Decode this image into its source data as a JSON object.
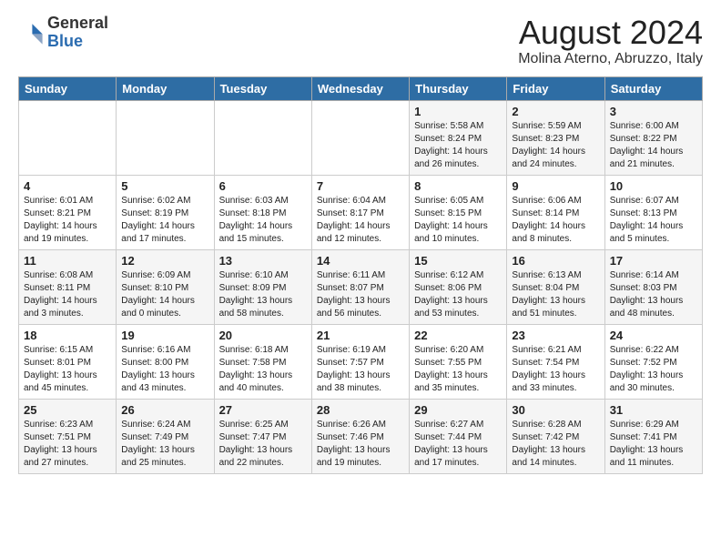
{
  "logo": {
    "general": "General",
    "blue": "Blue"
  },
  "header": {
    "month_year": "August 2024",
    "location": "Molina Aterno, Abruzzo, Italy"
  },
  "days_of_week": [
    "Sunday",
    "Monday",
    "Tuesday",
    "Wednesday",
    "Thursday",
    "Friday",
    "Saturday"
  ],
  "weeks": [
    [
      {
        "day": "",
        "info": ""
      },
      {
        "day": "",
        "info": ""
      },
      {
        "day": "",
        "info": ""
      },
      {
        "day": "",
        "info": ""
      },
      {
        "day": "1",
        "info": "Sunrise: 5:58 AM\nSunset: 8:24 PM\nDaylight: 14 hours\nand 26 minutes."
      },
      {
        "day": "2",
        "info": "Sunrise: 5:59 AM\nSunset: 8:23 PM\nDaylight: 14 hours\nand 24 minutes."
      },
      {
        "day": "3",
        "info": "Sunrise: 6:00 AM\nSunset: 8:22 PM\nDaylight: 14 hours\nand 21 minutes."
      }
    ],
    [
      {
        "day": "4",
        "info": "Sunrise: 6:01 AM\nSunset: 8:21 PM\nDaylight: 14 hours\nand 19 minutes."
      },
      {
        "day": "5",
        "info": "Sunrise: 6:02 AM\nSunset: 8:19 PM\nDaylight: 14 hours\nand 17 minutes."
      },
      {
        "day": "6",
        "info": "Sunrise: 6:03 AM\nSunset: 8:18 PM\nDaylight: 14 hours\nand 15 minutes."
      },
      {
        "day": "7",
        "info": "Sunrise: 6:04 AM\nSunset: 8:17 PM\nDaylight: 14 hours\nand 12 minutes."
      },
      {
        "day": "8",
        "info": "Sunrise: 6:05 AM\nSunset: 8:15 PM\nDaylight: 14 hours\nand 10 minutes."
      },
      {
        "day": "9",
        "info": "Sunrise: 6:06 AM\nSunset: 8:14 PM\nDaylight: 14 hours\nand 8 minutes."
      },
      {
        "day": "10",
        "info": "Sunrise: 6:07 AM\nSunset: 8:13 PM\nDaylight: 14 hours\nand 5 minutes."
      }
    ],
    [
      {
        "day": "11",
        "info": "Sunrise: 6:08 AM\nSunset: 8:11 PM\nDaylight: 14 hours\nand 3 minutes."
      },
      {
        "day": "12",
        "info": "Sunrise: 6:09 AM\nSunset: 8:10 PM\nDaylight: 14 hours\nand 0 minutes."
      },
      {
        "day": "13",
        "info": "Sunrise: 6:10 AM\nSunset: 8:09 PM\nDaylight: 13 hours\nand 58 minutes."
      },
      {
        "day": "14",
        "info": "Sunrise: 6:11 AM\nSunset: 8:07 PM\nDaylight: 13 hours\nand 56 minutes."
      },
      {
        "day": "15",
        "info": "Sunrise: 6:12 AM\nSunset: 8:06 PM\nDaylight: 13 hours\nand 53 minutes."
      },
      {
        "day": "16",
        "info": "Sunrise: 6:13 AM\nSunset: 8:04 PM\nDaylight: 13 hours\nand 51 minutes."
      },
      {
        "day": "17",
        "info": "Sunrise: 6:14 AM\nSunset: 8:03 PM\nDaylight: 13 hours\nand 48 minutes."
      }
    ],
    [
      {
        "day": "18",
        "info": "Sunrise: 6:15 AM\nSunset: 8:01 PM\nDaylight: 13 hours\nand 45 minutes."
      },
      {
        "day": "19",
        "info": "Sunrise: 6:16 AM\nSunset: 8:00 PM\nDaylight: 13 hours\nand 43 minutes."
      },
      {
        "day": "20",
        "info": "Sunrise: 6:18 AM\nSunset: 7:58 PM\nDaylight: 13 hours\nand 40 minutes."
      },
      {
        "day": "21",
        "info": "Sunrise: 6:19 AM\nSunset: 7:57 PM\nDaylight: 13 hours\nand 38 minutes."
      },
      {
        "day": "22",
        "info": "Sunrise: 6:20 AM\nSunset: 7:55 PM\nDaylight: 13 hours\nand 35 minutes."
      },
      {
        "day": "23",
        "info": "Sunrise: 6:21 AM\nSunset: 7:54 PM\nDaylight: 13 hours\nand 33 minutes."
      },
      {
        "day": "24",
        "info": "Sunrise: 6:22 AM\nSunset: 7:52 PM\nDaylight: 13 hours\nand 30 minutes."
      }
    ],
    [
      {
        "day": "25",
        "info": "Sunrise: 6:23 AM\nSunset: 7:51 PM\nDaylight: 13 hours\nand 27 minutes."
      },
      {
        "day": "26",
        "info": "Sunrise: 6:24 AM\nSunset: 7:49 PM\nDaylight: 13 hours\nand 25 minutes."
      },
      {
        "day": "27",
        "info": "Sunrise: 6:25 AM\nSunset: 7:47 PM\nDaylight: 13 hours\nand 22 minutes."
      },
      {
        "day": "28",
        "info": "Sunrise: 6:26 AM\nSunset: 7:46 PM\nDaylight: 13 hours\nand 19 minutes."
      },
      {
        "day": "29",
        "info": "Sunrise: 6:27 AM\nSunset: 7:44 PM\nDaylight: 13 hours\nand 17 minutes."
      },
      {
        "day": "30",
        "info": "Sunrise: 6:28 AM\nSunset: 7:42 PM\nDaylight: 13 hours\nand 14 minutes."
      },
      {
        "day": "31",
        "info": "Sunrise: 6:29 AM\nSunset: 7:41 PM\nDaylight: 13 hours\nand 11 minutes."
      }
    ]
  ]
}
